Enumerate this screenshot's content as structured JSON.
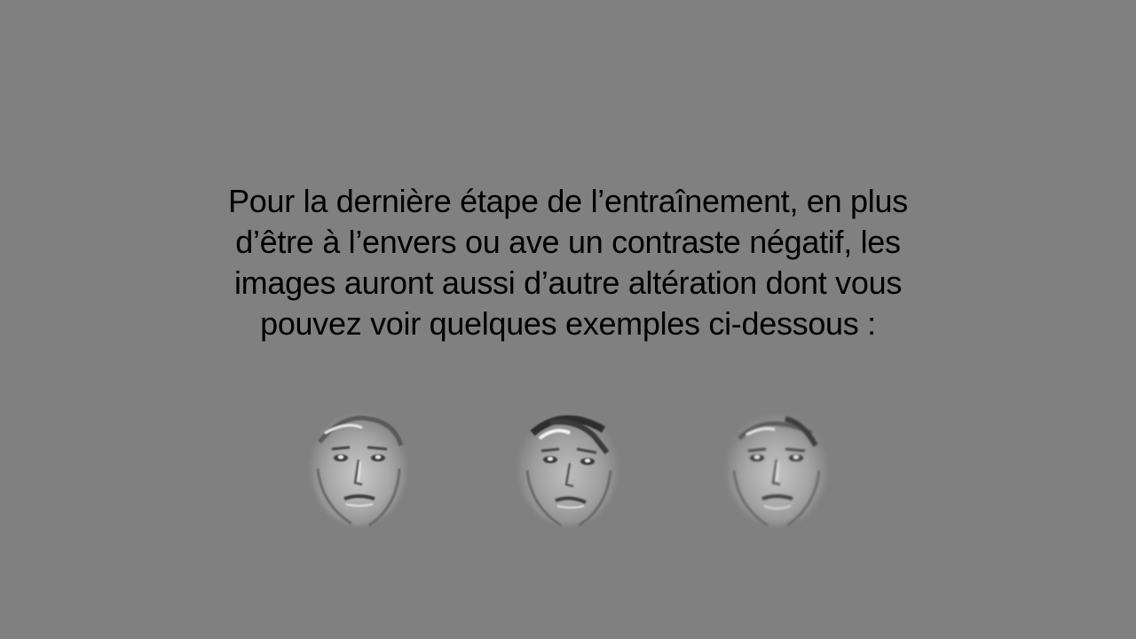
{
  "slide": {
    "background": "#808080",
    "text_color": "#000000",
    "instructions": {
      "line1": "Pour la dernière étape de l’entraînement, en plus",
      "line2": "d’être à l’envers ou ave un contraste négatif, les",
      "line3": "images auront aussi d’autre altération dont vous",
      "line4": "pouvez voir quelques exemples ci-dessous :"
    },
    "examples": [
      {
        "icon": "altered-face-image-1"
      },
      {
        "icon": "altered-face-image-2"
      },
      {
        "icon": "altered-face-image-3"
      }
    ]
  }
}
